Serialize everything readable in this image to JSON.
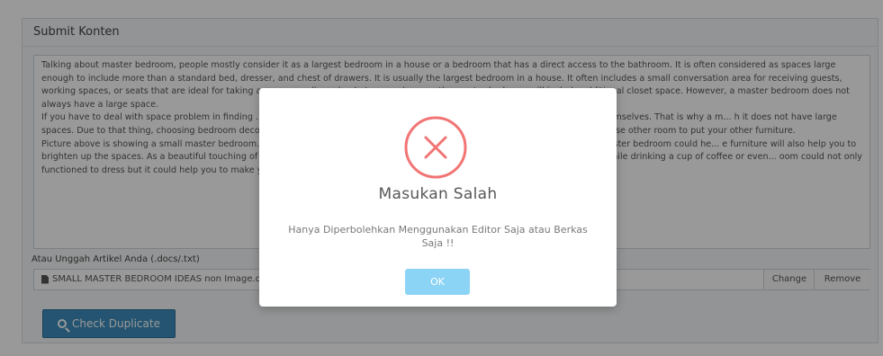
{
  "panel": {
    "title": "Submit Konten"
  },
  "article": {
    "paragraphs": [
      "Talking about master bedroom, people mostly consider it as a largest bedroom in a house or a bedroom that has a direct access to the bathroom. It is often considered as spaces large enough to include more than a standard bed, dresser, and chest of drawers. It is usually the largest bedroom in a house. It often includes a small conversation area for receiving guests, working spaces, or seats that are ideal for taking a nap or reading a book. In many houses, the master bedroom will include additional closet space. However, a master bedroom does not always have a large space.",
      "If you have to deal with space problem in finding ... room itself. It is the place where they could spend their private time only for themselves. That is why a m... h it does not have large spaces. Due to that thing, choosing bedroom decorating ideas smartly is im... ut primary needs in your master bedroom and could use other room to put your other furniture.",
      "Picture above is showing a small master bedroom... edroom if we could decorate it smartly. Using gray as the main color of your master bedroom could he... e furniture will also help you to brighten up the spaces. As a beautiful touching of your master be... e the bed could be a good spot where you will be served well while drinking a cup of coffee or even... oom could not only functioned to dress but it could help you to make your room looks wider."
    ]
  },
  "upload": {
    "label": "Atau Unggah Artikel Anda (.docs/.txt)",
    "file_name": "SMALL MASTER BEDROOM IDEAS non Image.do",
    "change_label": "Change",
    "remove_label": "Remove"
  },
  "actions": {
    "check_duplicate_label": "Check Duplicate"
  },
  "modal": {
    "icon": "error-x-icon",
    "title": "Masukan Salah",
    "message": "Hanya Diperbolehkan Menggunakan Editor Saja atau Berkas Saja !!",
    "ok_label": "OK"
  },
  "colors": {
    "primary_button": "#3c8dbc",
    "ok_button": "#8cd4f5",
    "error_red": "#f27474"
  }
}
